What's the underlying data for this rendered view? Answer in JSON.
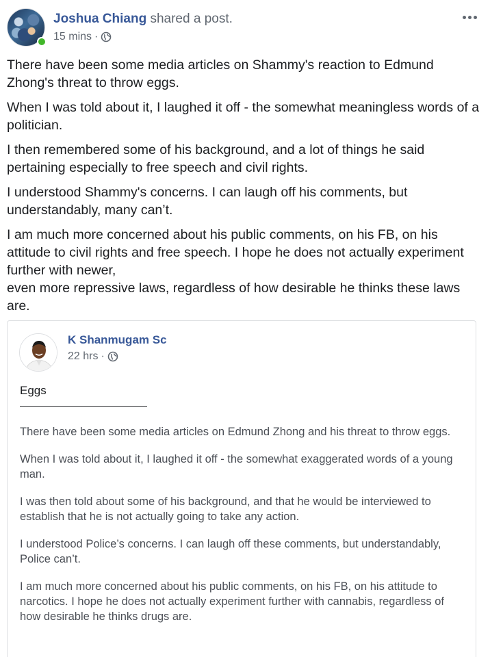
{
  "post": {
    "author": "Joshua Chiang",
    "action": "shared a post.",
    "time": "15 mins",
    "separator": "·",
    "privacy_icon": "globe-icon",
    "paragraphs": [
      "There have been some media articles on Shammy's reaction to Edmund Zhong's threat to throw eggs.",
      "When I was told about it, I laughed it off - the somewhat meaningless words of a politician.",
      "I then remembered some of his background, and a lot of things he said pertaining especially to free speech and civil rights.",
      "I understood Shammy's concerns. I can laugh off his comments, but understandably, many can’t.",
      "I am much more concerned about his public comments, on his FB, on his attitude to civil rights and free speech. I hope he does not actually experiment further with newer,",
      "even more repressive laws, regardless of how desirable he thinks these laws are."
    ]
  },
  "shared": {
    "author": "K Shanmugam Sc",
    "time": "22 hrs",
    "separator": "·",
    "privacy_icon": "globe-icon",
    "title": "Eggs",
    "paragraphs": [
      "There have been some media articles on Edmund Zhong and his threat to throw eggs.",
      "When I was told about it, I laughed it off - the somewhat exaggerated words of a young man.",
      "I was then told about some of his background, and that he would be interviewed to establish that he is not actually going to take any action.",
      "I understood Police’s concerns. I can laugh off these comments, but understandably, Police can’t.",
      "I am much more concerned about his public comments, on his FB, on his attitude to narcotics. I hope he does not actually experiment further with cannabis, regardless of how desirable he thinks drugs are."
    ]
  },
  "colors": {
    "link": "#385898",
    "meta": "#606770",
    "online": "#42b72a"
  }
}
